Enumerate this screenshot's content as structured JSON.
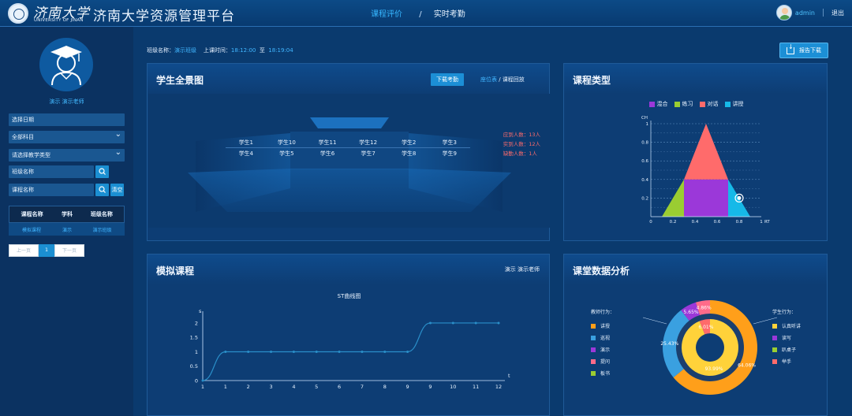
{
  "header": {
    "logo_cn": "济南大学",
    "logo_en": "UNIVERSITY OF JINAN",
    "title": "济南大学资源管理平台",
    "nav": [
      {
        "label": "课程评价",
        "active": true
      },
      {
        "label": "实时考勤",
        "active": false
      }
    ],
    "nav_separator": "/",
    "user": {
      "name": "admin",
      "logout_label": "退出"
    }
  },
  "sidebar": {
    "teacher_name": "演示 演示老师",
    "date_placeholder": "选择日期",
    "subject_select": "全部科目",
    "teaching_type_select": "请选择教学类型",
    "class_name_placeholder": "班级名称",
    "course_name_placeholder": "课程名称",
    "clear_label": "清空",
    "table": {
      "headers": [
        "课程名称",
        "学科",
        "班级名称"
      ],
      "rows": [
        [
          "模拟课程",
          "演示",
          "演示班级"
        ]
      ]
    },
    "pager": {
      "prev": "上一页",
      "current": "1",
      "next": "下一页"
    }
  },
  "infobar": {
    "class_label": "班级名称：",
    "class_value": "演示班级",
    "time_label": "上课时间：",
    "start": "18:12:00",
    "to": "至",
    "end": "18:19:04"
  },
  "report_button": "报告下载",
  "panorama": {
    "title": "学生全景图",
    "download_button": "下载考勤",
    "link_seat": "座位表",
    "link_sep": " / ",
    "link_replay": "课程回放",
    "stats": [
      "应到人数：13人",
      "实到人数：12人",
      "缺勤人数：1人"
    ],
    "seats": [
      [
        "学生1",
        "学生10",
        "学生11",
        "学生12",
        "学生2",
        "学生3"
      ],
      [
        "学生4",
        "学生5",
        "学生6",
        "学生7",
        "学生8",
        "学生9"
      ]
    ]
  },
  "course_type": {
    "title": "课程类型",
    "legend": [
      {
        "label": "混合",
        "color": "#9b38d9"
      },
      {
        "label": "练习",
        "color": "#9acd32"
      },
      {
        "label": "对话",
        "color": "#ff6b6b"
      },
      {
        "label": "讲授",
        "color": "#16b9e8"
      }
    ],
    "ylabel": "CH",
    "xlabel": "RT",
    "yticks": [
      "1",
      "0.8",
      "0.6",
      "0.4",
      "0.2"
    ],
    "xticks": [
      "0",
      "0.2",
      "0.4",
      "0.6",
      "0.8",
      "1"
    ]
  },
  "simulated_course": {
    "title": "模拟课程",
    "teacher_tag": "演示  演示老师",
    "chart_title": "ST曲线图"
  },
  "class_analysis": {
    "title": "课堂数据分析",
    "teacher_behavior_title": "教师行为：",
    "teacher_behaviors": [
      {
        "label": "讲授",
        "color": "#ff9f1a"
      },
      {
        "label": "巡视",
        "color": "#3aa0e0"
      },
      {
        "label": "演示",
        "color": "#9b38d9"
      },
      {
        "label": "提问",
        "color": "#ff6b8a"
      },
      {
        "label": "板书",
        "color": "#9acd32"
      }
    ],
    "student_behavior_title": "学生行为：",
    "student_behaviors": [
      {
        "label": "认真听讲",
        "color": "#ffd23a"
      },
      {
        "label": "读写",
        "color": "#9b38d9"
      },
      {
        "label": "趴桌子",
        "color": "#9acd32"
      },
      {
        "label": "举手",
        "color": "#ff6b6b"
      }
    ]
  },
  "chart_data": [
    {
      "type": "line",
      "title": "ST曲线图",
      "xlabel": "t",
      "ylabel": "s",
      "x": [
        0,
        1,
        2,
        3,
        4,
        5,
        6,
        7,
        8,
        9,
        10,
        11,
        12
      ],
      "xtick_labels": [
        "1",
        "1",
        "2",
        "3",
        "4",
        "5",
        "6",
        "7",
        "8",
        "9",
        "9",
        "10",
        "11",
        "12"
      ],
      "points": [
        {
          "t": 0,
          "s": 0
        },
        {
          "t": 1,
          "s": 1
        },
        {
          "t": 2,
          "s": 1
        },
        {
          "t": 3,
          "s": 1
        },
        {
          "t": 4,
          "s": 1
        },
        {
          "t": 5,
          "s": 1
        },
        {
          "t": 6,
          "s": 1
        },
        {
          "t": 7,
          "s": 1
        },
        {
          "t": 8,
          "s": 1
        },
        {
          "t": 9,
          "s": 1
        },
        {
          "t": 10,
          "s": 2
        },
        {
          "t": 11,
          "s": 2
        },
        {
          "t": 12,
          "s": 2
        },
        {
          "t": 13,
          "s": 2
        }
      ],
      "yticks": [
        "0",
        "0.5",
        "1",
        "1.5",
        "2"
      ],
      "ylim": [
        0,
        2.3
      ]
    },
    {
      "type": "pie",
      "title": "",
      "inner_ring": {
        "labels": [
          "认真听讲",
          "举手"
        ],
        "values": [
          93.99,
          6.01
        ],
        "value_labels": [
          "93.99%",
          "6.01%"
        ]
      },
      "outer_ring": {
        "labels": [
          "讲授",
          "巡视",
          "演示",
          "提问"
        ],
        "values": [
          64.06,
          25.43,
          5.65,
          4.86
        ],
        "value_labels": [
          "64.06%",
          "25.43%",
          "5.65%",
          "4.86%"
        ]
      }
    },
    {
      "type": "area",
      "title": "",
      "xlabel": "RT",
      "ylabel": "CH",
      "regions": [
        {
          "label": "练习",
          "polygon": [
            [
              0.1,
              0
            ],
            [
              0.3,
              0
            ],
            [
              0.3,
              0.4
            ]
          ]
        },
        {
          "label": "混合",
          "polygon": [
            [
              0.3,
              0
            ],
            [
              0.7,
              0
            ],
            [
              0.7,
              0.4
            ],
            [
              0.3,
              0.4
            ]
          ]
        },
        {
          "label": "讲授",
          "polygon": [
            [
              0.7,
              0
            ],
            [
              0.9,
              0
            ],
            [
              0.7,
              0.4
            ]
          ]
        },
        {
          "label": "对话",
          "polygon": [
            [
              0.3,
              0.4
            ],
            [
              0.7,
              0.4
            ],
            [
              0.5,
              1
            ]
          ]
        }
      ],
      "point": {
        "rt": 0.8,
        "ch": 0.2
      },
      "xlim": [
        0,
        1
      ],
      "ylim": [
        0,
        1
      ]
    }
  ]
}
